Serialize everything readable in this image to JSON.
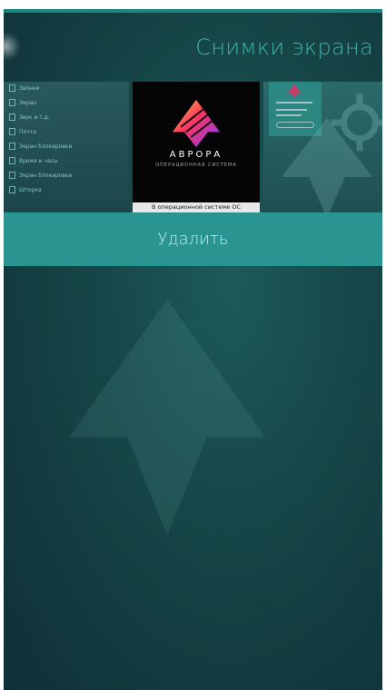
{
  "header": {
    "title": "Снимки экрана"
  },
  "preview": {
    "settings_items": [
      "Звонки",
      "Экран",
      "Звук и т.д.",
      "Почта",
      "Экран блокировки",
      "Время и часы",
      "Экран блокировки",
      "Шторка"
    ],
    "aurora_brand": "АВРОРА",
    "aurora_subtitle": "ОПЕРАЦИОННАЯ СИСТЕМА",
    "aurora_caption": "В операционной системе ОС"
  },
  "actions": {
    "delete_label": "Удалить"
  },
  "colors": {
    "accent": "#2a9590",
    "title": "#3fb0a8",
    "background": "#164546"
  }
}
